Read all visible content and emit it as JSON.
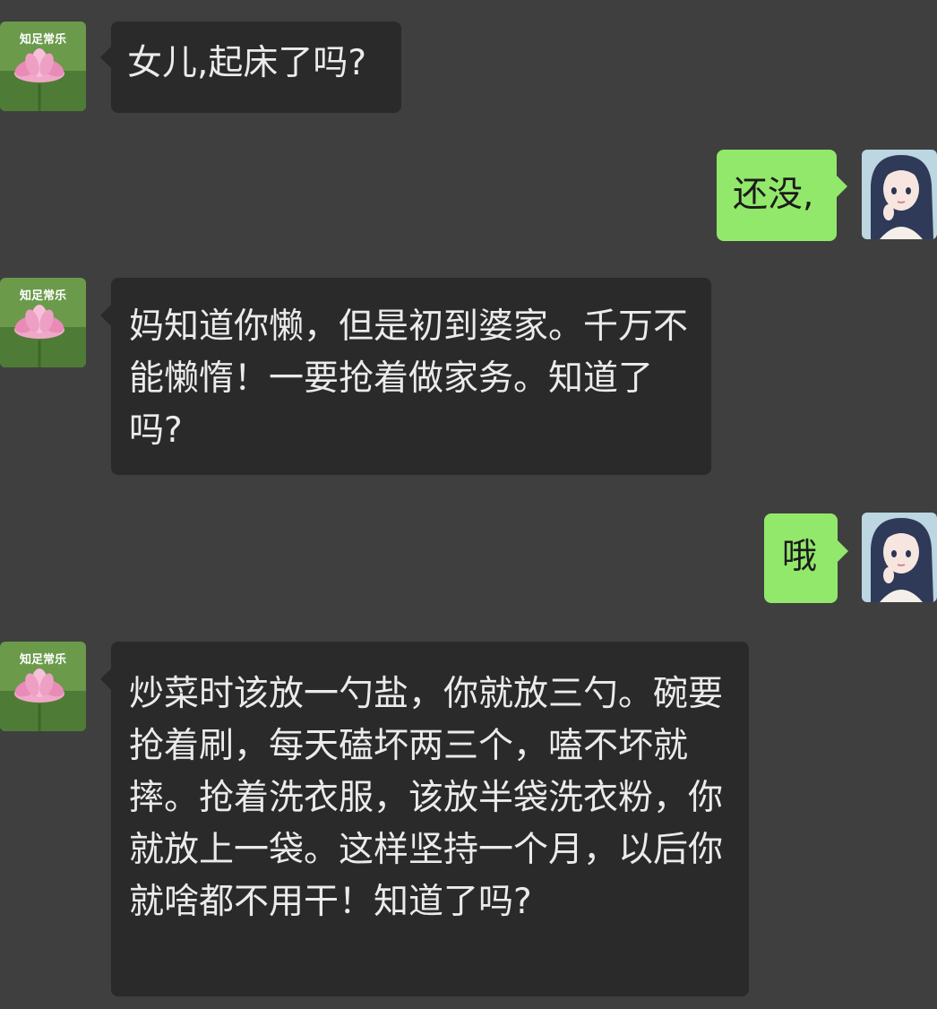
{
  "chat": {
    "contact_avatar_text": "知足常乐",
    "contact_avatar_icon": "lotus-flower-icon",
    "self_avatar_icon": "anime-girl-portrait-icon",
    "colors": {
      "background": "#3f3f3f",
      "incoming_bubble": "#2a2a2a",
      "outgoing_bubble": "#92e86a"
    },
    "messages": [
      {
        "side": "incoming",
        "text": "女儿,起床了吗?"
      },
      {
        "side": "outgoing",
        "text": "还没,"
      },
      {
        "side": "incoming",
        "text": "妈知道你懒，但是初到婆家。千万不能懒惰！一要抢着做家务。知道了吗?"
      },
      {
        "side": "outgoing",
        "text": "哦"
      },
      {
        "side": "incoming",
        "text": "炒菜时该放一勺盐，你就放三勺。碗要抢着刷，每天磕坏两三个，嗑不坏就摔。抢着洗衣服，该放半袋洗衣粉，你就放上一袋。这样坚持一个月，以后你就啥都不用干！知道了吗?"
      }
    ]
  }
}
